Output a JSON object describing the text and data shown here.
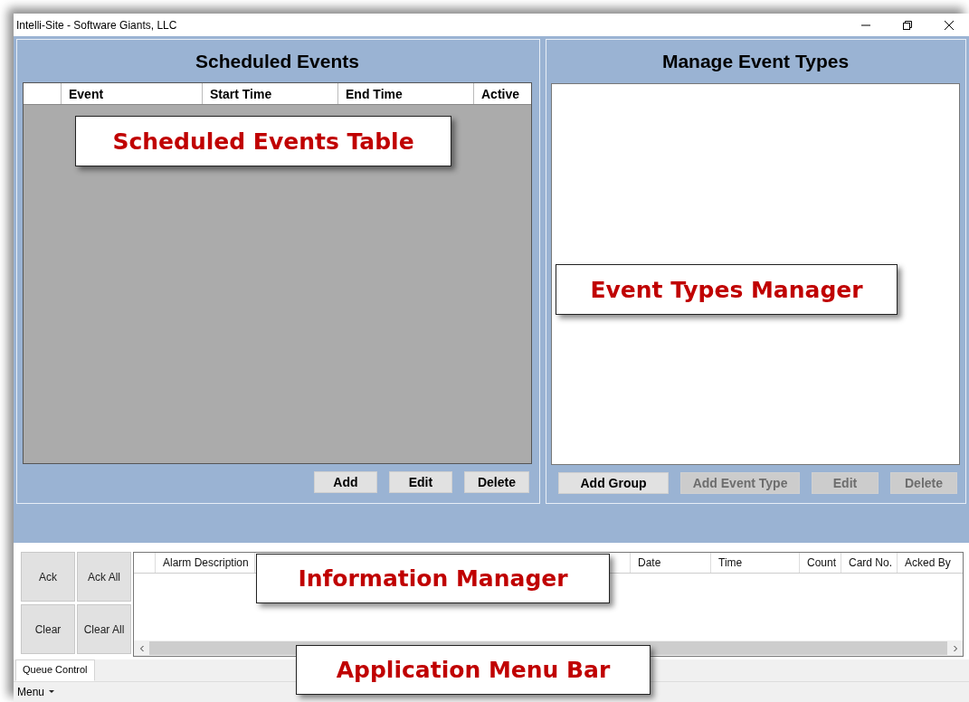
{
  "window": {
    "title": "Intelli-Site - Software Giants, LLC"
  },
  "scheduled_events": {
    "title": "Scheduled Events",
    "columns": [
      "Event",
      "Start Time",
      "End Time",
      "Active"
    ],
    "callout": "Scheduled Events Table",
    "buttons": [
      {
        "label": "Add",
        "disabled": false
      },
      {
        "label": "Edit",
        "disabled": false
      },
      {
        "label": "Delete",
        "disabled": false
      }
    ]
  },
  "event_types": {
    "title": "Manage Event Types",
    "callout": "Event Types Manager",
    "buttons": [
      {
        "label": "Add Group",
        "disabled": false
      },
      {
        "label": "Add Event Type",
        "disabled": true
      },
      {
        "label": "Edit",
        "disabled": true
      },
      {
        "label": "Delete",
        "disabled": true
      }
    ]
  },
  "queue_buttons": [
    "Ack",
    "Ack All",
    "Clear",
    "Clear All"
  ],
  "alarm_table": {
    "columns": [
      "Alarm Description",
      "Date",
      "Time",
      "Count",
      "Card No.",
      "Acked By"
    ],
    "callout": "Information Manager"
  },
  "tabs": [
    {
      "label": "Queue Control",
      "selected": true
    }
  ],
  "menu_bar": {
    "label": "Menu",
    "callout": "Application Menu Bar"
  }
}
